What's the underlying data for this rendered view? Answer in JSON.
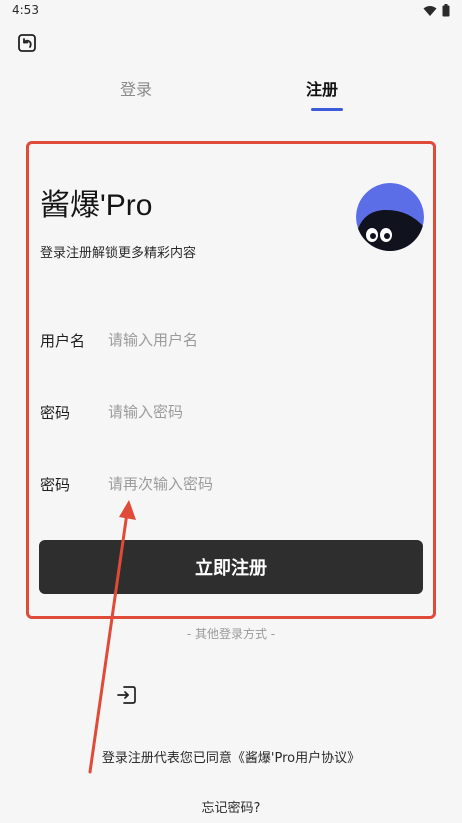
{
  "status_bar": {
    "time": "4:53"
  },
  "tabs": {
    "login_label": "登录",
    "register_label": "注册"
  },
  "brand": {
    "title": "酱爆'Pro",
    "subtitle": "登录注册解锁更多精彩内容"
  },
  "form": {
    "username": {
      "label": "用户名",
      "placeholder": "请输入用户名",
      "value": ""
    },
    "password": {
      "label": "密码",
      "placeholder": "请输入密码",
      "value": ""
    },
    "confirm_password": {
      "label": "密码",
      "placeholder": "请再次输入密码",
      "value": ""
    },
    "submit_label": "立即注册"
  },
  "other_methods_label": "- 其他登录方式 -",
  "agreement_text": "登录注册代表您已同意《酱爆'Pro用户协议》",
  "forgot_password_label": "忘记密码?",
  "icons": {
    "back": "back-icon",
    "alt_login": "login-enter-icon",
    "wifi": "wifi-icon",
    "battery": "battery-icon",
    "avatar": "mascot-avatar"
  },
  "colors": {
    "accent": "#3b5bdb",
    "highlight_frame": "#e04a38",
    "submit_bg": "#2e2e2e",
    "avatar_bg": "#5b6ee8"
  }
}
